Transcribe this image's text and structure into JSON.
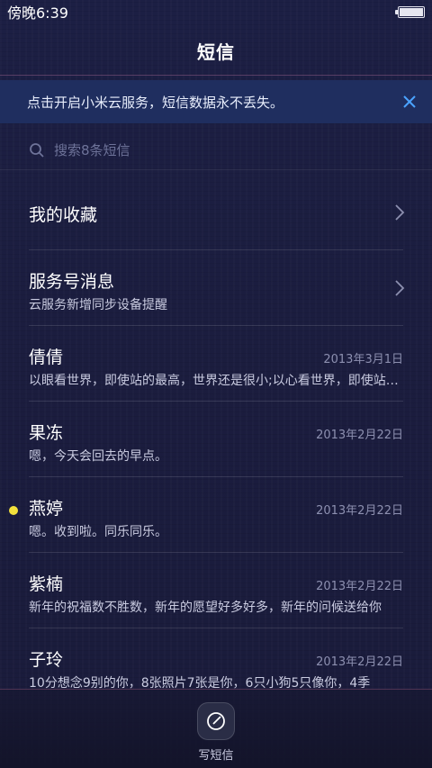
{
  "status_bar": {
    "time": "傍晚6:39"
  },
  "header": {
    "title": "短信"
  },
  "banner": {
    "text": "点击开启小米云服务，短信数据永不丢失。"
  },
  "search": {
    "placeholder": "搜索8条短信"
  },
  "list": {
    "favorites": {
      "title": "我的收藏"
    },
    "service": {
      "title": "服务号消息",
      "subtitle": "云服务新增同步设备提醒"
    },
    "conversations": [
      {
        "name": "倩倩",
        "date": "2013年3月1日",
        "preview": "以眼看世界，即使站的最高，世界还是很小;以心看世界，即使站的最低，世界也是无限大",
        "unread": false
      },
      {
        "name": "果冻",
        "date": "2013年2月22日",
        "preview": "嗯，今天会回去的早点。",
        "unread": false
      },
      {
        "name": "燕婷",
        "date": "2013年2月22日",
        "preview": "嗯。收到啦。同乐同乐。",
        "unread": true
      },
      {
        "name": "紫楠",
        "date": "2013年2月22日",
        "preview": "新年的祝福数不胜数，新年的愿望好多好多，新年的问候送给你",
        "unread": false
      },
      {
        "name": "子玲",
        "date": "2013年2月22日",
        "preview": "10分想念9别的你，8张照片7张是你，6只小狗5只像你，4季",
        "unread": false
      }
    ]
  },
  "bottom_bar": {
    "compose_label": "写短信"
  },
  "colors": {
    "accent": "#4aa3ff",
    "unread_dot": "#f3e13c",
    "banner_bg": "#1f2e5f"
  }
}
